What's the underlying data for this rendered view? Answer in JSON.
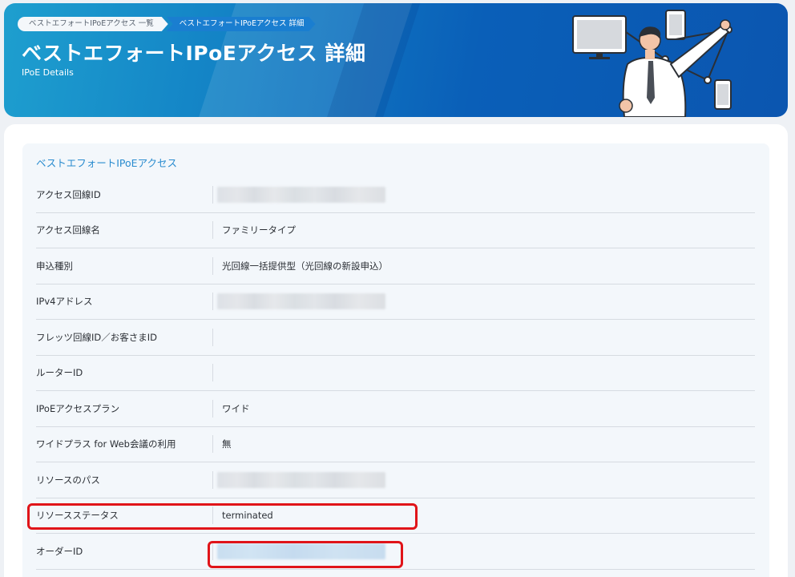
{
  "breadcrumb": {
    "items": [
      "ベストエフォートIPoEアクセス 一覧",
      "ベストエフォートIPoEアクセス 詳細"
    ]
  },
  "header": {
    "title": "ベストエフォートIPoEアクセス 詳細",
    "subtitle": "IPoE Details"
  },
  "section": {
    "title": "ベストエフォートIPoEアクセス",
    "rows": [
      {
        "label": "アクセス回線ID",
        "value": "",
        "redacted": true
      },
      {
        "label": "アクセス回線名",
        "value": "ファミリータイプ",
        "redacted": false
      },
      {
        "label": "申込種別",
        "value": "光回線一括提供型（光回線の新設申込）",
        "redacted": false
      },
      {
        "label": "IPv4アドレス",
        "value": "",
        "redacted": true
      },
      {
        "label": "フレッツ回線ID／お客さまID",
        "value": "",
        "redacted": false
      },
      {
        "label": "ルーターID",
        "value": "",
        "redacted": false
      },
      {
        "label": "IPoEアクセスプラン",
        "value": "ワイド",
        "redacted": false
      },
      {
        "label": "ワイドプラス for Web会議の利用",
        "value": "無",
        "redacted": false
      },
      {
        "label": "リソースのパス",
        "value": "",
        "redacted": true
      },
      {
        "label": "リソースステータス",
        "value": "terminated",
        "redacted": false
      },
      {
        "label": "オーダーID",
        "value": "",
        "redacted": true
      }
    ]
  },
  "colors": {
    "banner_start": "#1e9fcf",
    "banner_end": "#0b56b0",
    "section_title": "#2a8ccf",
    "highlight": "#e01419"
  }
}
